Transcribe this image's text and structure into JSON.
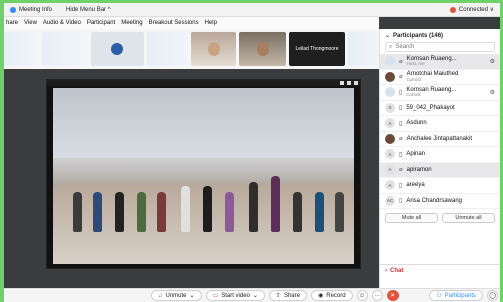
{
  "meeting_bar": {
    "meeting_info": "Meeting Info",
    "hide_menu": "Hide Menu Bar ^",
    "connected": "Connected ∨"
  },
  "menu": [
    "hare",
    "View",
    "Audio & Video",
    "Participant",
    "Meeting",
    "Breakout Sessions",
    "Help"
  ],
  "gallery": {
    "named_tile": "Leilad Thongmoore"
  },
  "participants_panel": {
    "title": "Participants (146)",
    "search_placeholder": "Search",
    "rows": [
      {
        "avatar": "",
        "name": "Kornsan Ruaeng...",
        "role": "Host, me"
      },
      {
        "avatar": "",
        "name": "Arnotchai Maiuthed",
        "role": "Cohost"
      },
      {
        "avatar": "",
        "name": "Kornsan Ruaeng...",
        "role": "Cohost"
      },
      {
        "avatar": "S",
        "name": "59_042_Phakayot",
        "role": ""
      },
      {
        "avatar": "A",
        "name": "Asdunn",
        "role": ""
      },
      {
        "avatar": "",
        "name": "Anchalee Jintapattanakit",
        "role": ""
      },
      {
        "avatar": "A",
        "name": "Apinan",
        "role": ""
      },
      {
        "avatar": "A",
        "name": "apiramon",
        "role": ""
      },
      {
        "avatar": "A",
        "name": "areeya",
        "role": ""
      },
      {
        "avatar": "AC",
        "name": "Arisa Chandrsawang",
        "role": ""
      }
    ],
    "mute_all": "Mute all",
    "unmute_all": "Unmute all",
    "chat": "Chat"
  },
  "toolbar": {
    "unmute": "Unmute",
    "start_video": "Start video",
    "share": "Share",
    "record": "Record",
    "more": "···",
    "end": "×",
    "participants": "Participants"
  }
}
